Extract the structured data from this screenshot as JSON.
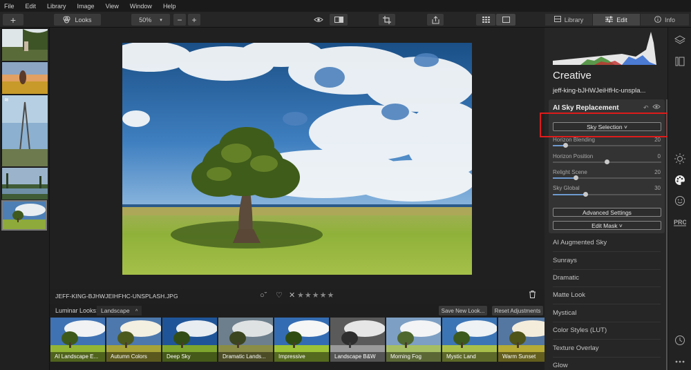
{
  "menu": [
    "File",
    "Edit",
    "Library",
    "Image",
    "View",
    "Window",
    "Help"
  ],
  "toolbar": {
    "add_label": "+",
    "looks_label": "Looks",
    "zoom": "50%",
    "zoom_out": "−",
    "zoom_in": "+"
  },
  "top_tabs": {
    "library": "Library",
    "edit": "Edit",
    "info": "Info"
  },
  "image": {
    "filename": "JEFF-KING-BJHWJEIHFHC-UNSPLASH.JPG"
  },
  "looks": {
    "label": "Luminar Looks:",
    "category": "Landscape",
    "save_new": "Save New Look...",
    "reset": "Reset Adjustments",
    "items": [
      "AI Landscape E...",
      "Autumn Colors",
      "Deep Sky",
      "Dramatic Lands...",
      "Impressive",
      "Landscape B&W",
      "Morning Fog",
      "Mystic Land",
      "Warm Sunset"
    ]
  },
  "panel": {
    "section": "Creative",
    "file": "jeff-king-bJHWJeiHfHc-unspla...",
    "tool_title": "AI Sky Replacement",
    "sky_selection": "Sky Selection ˅",
    "sliders": [
      {
        "label": "Horizon Blending",
        "value": "20",
        "fraction": 0.12
      },
      {
        "label": "Horizon Position",
        "value": "0",
        "fraction": 0.5
      },
      {
        "label": "Relight Scene",
        "value": "20",
        "fraction": 0.22
      },
      {
        "label": "Sky Global",
        "value": "30",
        "fraction": 0.3
      }
    ],
    "advanced": "Advanced Settings",
    "edit_mask": "Edit Mask ˅",
    "tools": [
      "AI Augmented Sky",
      "Sunrays",
      "Dramatic",
      "Matte Look",
      "Mystical",
      "Color Styles (LUT)",
      "Texture Overlay",
      "Glow"
    ]
  },
  "colors": {
    "accent": "#6e9ad0",
    "highlight": "#e01b1b"
  }
}
